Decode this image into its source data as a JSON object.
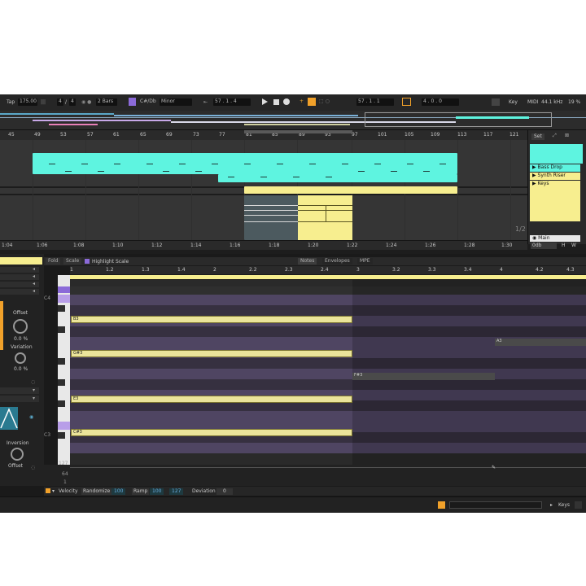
{
  "transport": {
    "tap": "Tap",
    "tempo": "175.00",
    "signature_num": "4",
    "signature_den": "4",
    "loop_length": "2 Bars",
    "scale_root": "C#/Db",
    "scale_mode": "Minor",
    "position": "57 . 1 . 4",
    "loop_pos": "57 . 1 . 1",
    "loop_len": "4 . 0 . 0",
    "key_label": "Key",
    "midi_label": "MIDI",
    "sample_rate": "44.1 kHz",
    "cpu": "19 %"
  },
  "arrangement": {
    "bar_labels": [
      "45",
      "49",
      "53",
      "57",
      "61",
      "65",
      "69",
      "73",
      "77",
      "81",
      "85",
      "89",
      "93",
      "97",
      "101",
      "105",
      "109",
      "113",
      "117",
      "121"
    ],
    "time_labels": [
      "1:04",
      "1:06",
      "1:08",
      "1:10",
      "1:12",
      "1:14",
      "1:16",
      "1:18",
      "1:20",
      "1:22",
      "1:24",
      "1:26",
      "1:28",
      "1:30"
    ],
    "set_label": "Set",
    "tracks": [
      {
        "name": "Bass Drop",
        "color": "#5ef4e0"
      },
      {
        "name": "Synth Riser",
        "color": "#f7ee8f"
      },
      {
        "name": "Keys",
        "color": "#f7ee8f"
      }
    ],
    "page_indicator": "1/2",
    "main_label": "Main",
    "main_value": "0db",
    "buttons": [
      "H",
      "W"
    ]
  },
  "clip_panel": {
    "tabs": [
      "Fold",
      "Scale"
    ],
    "highlight_scale": "Highlight Scale",
    "editor_tabs": [
      "Notes",
      "Envelopes",
      "MPE"
    ],
    "ruler": [
      "1",
      "1.2",
      "1.3",
      "1.4",
      "2",
      "2.2",
      "2.3",
      "2.4",
      "3",
      "3.2",
      "3.3",
      "3.4",
      "4",
      "4.2",
      "4.3"
    ],
    "octave_labels": [
      "C4",
      "C3"
    ],
    "notes": [
      {
        "label": "B3",
        "kind": "active"
      },
      {
        "label": "G#3",
        "kind": "active"
      },
      {
        "label": "E3",
        "kind": "active"
      },
      {
        "label": "C#3",
        "kind": "active"
      },
      {
        "label": "A3",
        "kind": "ghost"
      },
      {
        "label": "F#3",
        "kind": "ghost"
      }
    ],
    "velocity_axis": [
      "127",
      "64",
      "1"
    ]
  },
  "device": {
    "offset_label": "Offset",
    "offset_value": "0.0 %",
    "variation_label": "Variation",
    "variation_value": "0.0 %",
    "inversion_label": "Inversion",
    "offset_label2": "Offset"
  },
  "bottom_bar": {
    "velocity": "Velocity",
    "randomize": "Randomize",
    "randomize_value": "100",
    "ramp": "Ramp",
    "ramp_from": "100",
    "ramp_to": "127",
    "deviation": "Deviation",
    "deviation_value": "0"
  },
  "status": {
    "track": "Keys"
  },
  "colors": {
    "cyan_clip": "#5ef4e0",
    "yellow_clip": "#f7ee8f",
    "note_fill": "#ebe49a",
    "scale_lane": "#4f4562",
    "accent_orange": "#f1a12a",
    "purple": "#8b6ad8"
  }
}
